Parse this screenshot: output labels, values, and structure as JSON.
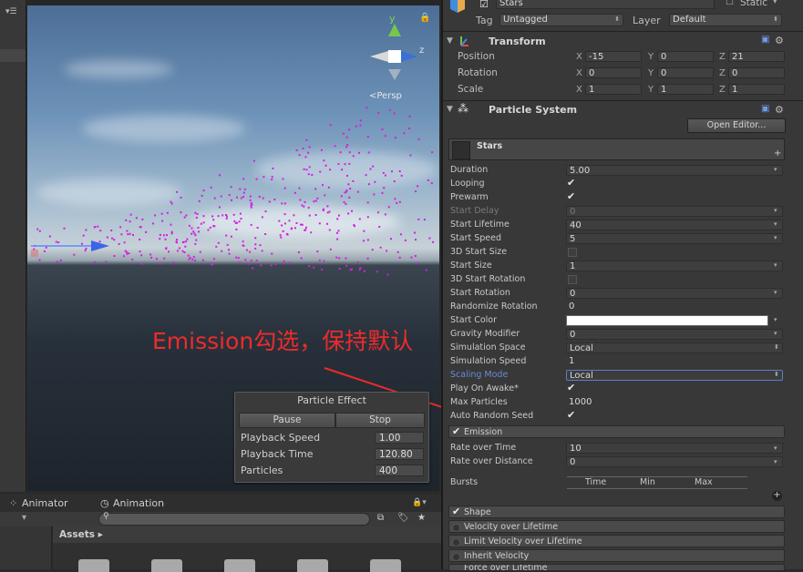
{
  "inspector": {
    "object_name": "Stars",
    "static_label": "Static",
    "tag_label": "Tag",
    "tag_value": "Untagged",
    "layer_label": "Layer",
    "layer_value": "Default",
    "transform": {
      "title": "Transform",
      "rows": [
        {
          "label": "Position",
          "x": "-15",
          "y": "0",
          "z": "21"
        },
        {
          "label": "Rotation",
          "x": "0",
          "y": "0",
          "z": "0"
        },
        {
          "label": "Scale",
          "x": "1",
          "y": "1",
          "z": "1"
        }
      ],
      "axis_x": "X",
      "axis_y": "Y",
      "axis_z": "Z"
    },
    "particle_system": {
      "title": "Particle System",
      "open_editor": "Open Editor...",
      "module_name": "Stars",
      "props": [
        {
          "label": "Duration",
          "value": "5.00",
          "kind": "box"
        },
        {
          "label": "Looping",
          "value": "✔",
          "kind": "check"
        },
        {
          "label": "Prewarm",
          "value": "✔",
          "kind": "check"
        },
        {
          "label": "Start Delay",
          "value": "0",
          "kind": "box-dis"
        },
        {
          "label": "Start Lifetime",
          "value": "40",
          "kind": "box"
        },
        {
          "label": "Start Speed",
          "value": "5",
          "kind": "box"
        },
        {
          "label": "3D Start Size",
          "value": "",
          "kind": "ghost"
        },
        {
          "label": "Start Size",
          "value": "1",
          "kind": "box"
        },
        {
          "label": "3D Start Rotation",
          "value": "",
          "kind": "ghost"
        },
        {
          "label": "Start Rotation",
          "value": "0",
          "kind": "box"
        },
        {
          "label": "Randomize Rotation",
          "value": "0",
          "kind": "box-nocaret"
        },
        {
          "label": "Start Color",
          "value": "",
          "kind": "white"
        },
        {
          "label": "Gravity Modifier",
          "value": "0",
          "kind": "box"
        },
        {
          "label": "Simulation Space",
          "value": "Local",
          "kind": "dropdown"
        },
        {
          "label": "Simulation Speed",
          "value": "1",
          "kind": "box-nocaret"
        },
        {
          "label": "Scaling Mode",
          "value": "Local",
          "kind": "dropdown-active"
        },
        {
          "label": "Play On Awake*",
          "value": "✔",
          "kind": "check"
        },
        {
          "label": "Max Particles",
          "value": "1000",
          "kind": "box-nocaret"
        },
        {
          "label": "Auto Random Seed",
          "value": "✔",
          "kind": "check"
        }
      ],
      "emission": {
        "title": "Emission",
        "rows": [
          {
            "label": "Rate over Time",
            "value": "10"
          },
          {
            "label": "Rate over Distance",
            "value": "0"
          }
        ],
        "bursts_label": "Bursts",
        "bursts_cols": [
          "Time",
          "Min",
          "Max"
        ]
      },
      "modules": [
        {
          "label": "Shape",
          "checked": true
        },
        {
          "label": "Velocity over Lifetime",
          "checked": false
        },
        {
          "label": "Limit Velocity over Lifetime",
          "checked": false
        },
        {
          "label": "Inherit Velocity",
          "checked": false
        },
        {
          "label": "Force over Lifetime",
          "checked": false
        }
      ]
    }
  },
  "scene": {
    "persp_label": "<Persp",
    "annotation": "Emission勾选，保持默认",
    "gizmo": {
      "y": "y",
      "z": "z"
    }
  },
  "particle_effect": {
    "title": "Particle Effect",
    "pause": "Pause",
    "stop": "Stop",
    "rows": [
      {
        "label": "Playback Speed",
        "value": "1.00"
      },
      {
        "label": "Playback Time",
        "value": "120.80"
      },
      {
        "label": "Particles",
        "value": "400"
      }
    ]
  },
  "bottom": {
    "tab_animator": "Animator",
    "tab_animation": "Animation",
    "assets_label": "Assets ▸"
  },
  "colors": {
    "annotation": "#ee2b2b",
    "particles": "#d21fe0",
    "scaling_mode": "#6a8bd6"
  }
}
